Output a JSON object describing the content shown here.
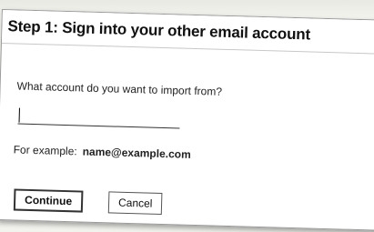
{
  "dialog": {
    "title": "Step 1: Sign into your other email account",
    "question": "What account do you want to import from?",
    "account_input": {
      "value": "",
      "placeholder": ""
    },
    "example_prefix": "For example:",
    "example_address": "name@example.com",
    "continue_label": "Continue",
    "cancel_label": "Cancel"
  }
}
